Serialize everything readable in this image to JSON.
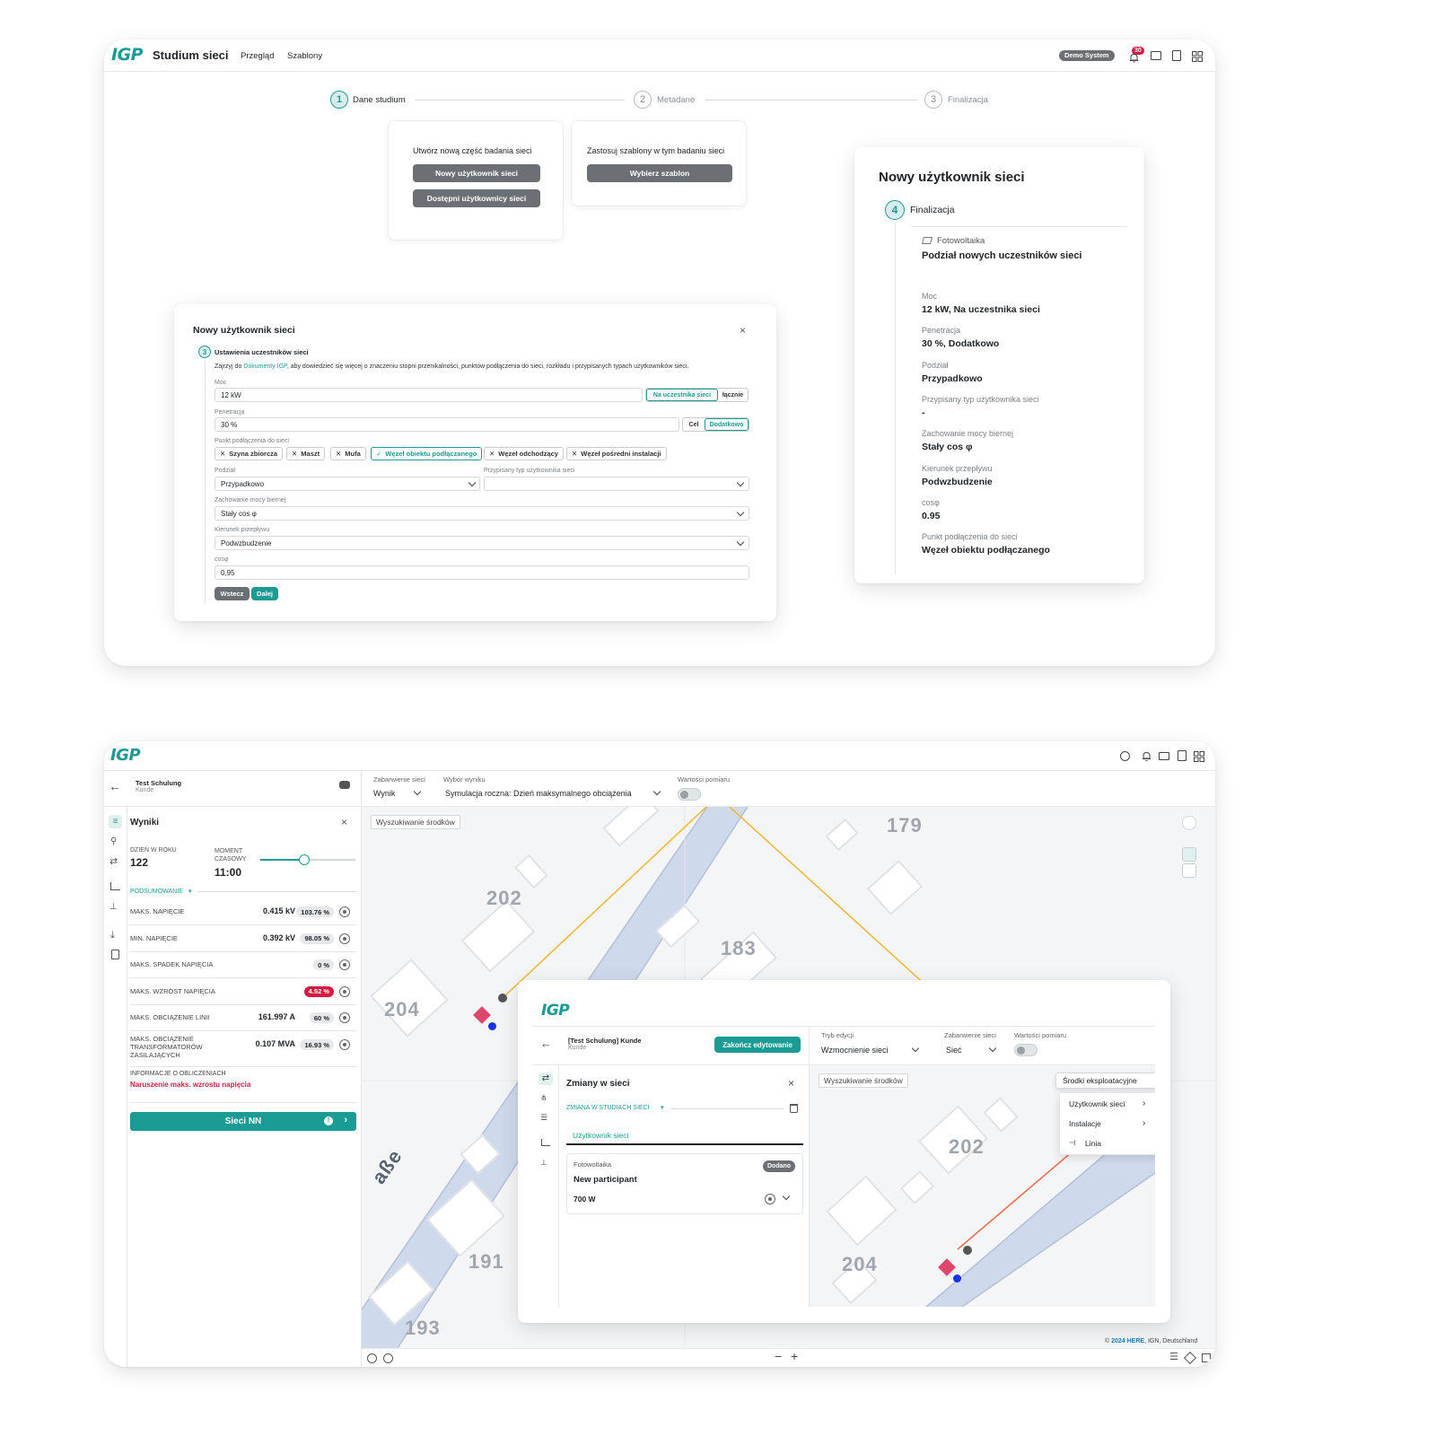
{
  "top": {
    "logo": "IGP",
    "app_title": "Studium sieci",
    "nav": [
      "Przegląd",
      "Szablony"
    ],
    "demo_badge": "Demo System",
    "notification_count": "30",
    "steps": [
      {
        "num": "1",
        "label": "Dane studium"
      },
      {
        "num": "2",
        "label": "Metadane"
      },
      {
        "num": "3",
        "label": "Finalizacja"
      }
    ],
    "create_card": {
      "text": "Utwórz nową część badania sieci",
      "btn_new": "Nowy użytkownik sieci",
      "btn_available": "Dostępni użytkownicy sieci"
    },
    "template_card": {
      "text": "Zastosuj szablony w tym badaniu sieci",
      "btn": "Wybierz szablon"
    },
    "dialog": {
      "title": "Nowy użytkownik sieci",
      "step_num": "3",
      "step_title": "Ustawienia uczestników sieci",
      "info_prefix": "Zajrzyj do ",
      "info_link": "Dokumenty IGP",
      "info_suffix": ", aby dowiedzieć się więcej o znaczeniu stopni przenikalności, punktów podłączenia do sieci, rozkładu i przypisanych typach użytkowników sieci.",
      "moc_label": "Moc",
      "moc_value": "12 kW",
      "moc_opt1": "Na uczestnika sieci",
      "moc_opt2": "łącznie",
      "pen_label": "Penetracja",
      "pen_value": "30 %",
      "pen_opt1": "Cel",
      "pen_opt2": "Dodatkowo",
      "punkt_label": "Punkt podłączenia do sieci",
      "chips": [
        "Szyna zbiorcza",
        "Maszt",
        "Mufa",
        "Węzeł obiektu podłączanego",
        "Węzeł odchodzący",
        "Węzeł pośredni instalacji"
      ],
      "podzial_label": "Podział",
      "podzial_value": "Przypadkowo",
      "typ_label": "Przypisany typ użytkownika sieci",
      "typ_value": "",
      "zach_label": "Zachowanie mocy biernej",
      "zach_value": "Stały cos φ",
      "kier_label": "Kierunek przepływu",
      "kier_value": "Podwzbudzenie",
      "cos_label": "cosφ",
      "cos_value": "0,95",
      "btn_back": "Wstecz",
      "btn_next": "Dalej"
    },
    "final_card": {
      "title": "Nowy użytkownik sieci",
      "step_num": "4",
      "step_label": "Finalizacja",
      "category": "Fotowoltaika",
      "subtitle": "Podział nowych uczestników sieci",
      "fields": [
        {
          "label": "Moc",
          "value": "12 kW, Na uczestnika sieci"
        },
        {
          "label": "Penetracja",
          "value": "30 %, Dodatkowo"
        },
        {
          "label": "Podział",
          "value": "Przypadkowo"
        },
        {
          "label": "Przypisany typ użytkownika sieci",
          "value": "-"
        },
        {
          "label": "Zachowanie mocy biernej",
          "value": "Stały cos φ"
        },
        {
          "label": "Kierunek przepływu",
          "value": "Podwzbudzenie"
        },
        {
          "label": "cosφ",
          "value": "0.95"
        },
        {
          "label": "Punkt podłączenia do sieci",
          "value": "Węzeł obiektu podłączanego"
        }
      ]
    }
  },
  "bottom": {
    "logo": "IGP",
    "project_title": "Test Schulung",
    "project_sub": "Kunde",
    "toolbar": {
      "colour_label": "Zabarwienie sieci",
      "colour_value": "Wynik",
      "result_label": "Wybór wyniku",
      "result_value": "Symulacja roczna: Dzień maksymalnego obciążenia",
      "measure_label": "Wartości pomiaru"
    },
    "search_btn": "Wyszukiwanie środków",
    "results": {
      "title": "Wyniki",
      "day_label": "DZIEŃ W ROKU",
      "day_value": "122",
      "moment_label": "MOMENT CZASOWY",
      "moment_value": "11:00",
      "slider_fraction": 0.46,
      "summary_label": "PODSUMOWANIE",
      "rows": [
        {
          "label": "MAKS. NAPIĘCIE",
          "value": "0.415 kV",
          "pct": "103.76 %",
          "red": false
        },
        {
          "label": "MIN. NAPIĘCIE",
          "value": "0.392 kV",
          "pct": "98.05 %",
          "red": false
        },
        {
          "label": "MAKS. SPADEK NAPIĘCIA",
          "value": "",
          "pct": "0 %",
          "red": false
        },
        {
          "label": "MAKS. WZROST NAPIĘCIA",
          "value": "",
          "pct": "4.52 %",
          "red": true
        },
        {
          "label": "MAKS. OBCIĄŻENIE LINII",
          "value": "161.997 A",
          "pct": "60 %",
          "red": false
        },
        {
          "label": "MAKS. OBCIĄŻENIE TRANSFORMATORÓW ZASILAJĄCYCH",
          "value": "0.107 MVA",
          "pct": "16.93 %",
          "red": false
        }
      ],
      "info_label": "INFORMACJE O OBLICZENIACH",
      "info_error": "Naruszenie maks. wzrostu napięcia",
      "nn_button": "Sieci NN"
    },
    "map_labels": [
      "179",
      "202",
      "183",
      "204",
      "191",
      "193",
      "aße"
    ],
    "attribution_prefix": "© ",
    "attribution_link": "2024 HERE",
    "attribution_suffix": ", IGN, Deutschland",
    "inner": {
      "logo": "IGP",
      "project_title": "[Test Schulung] Kunde",
      "project_sub": "Kunde",
      "end_edit_btn": "Zakończ edytowanie",
      "mode_label": "Tryb edycji",
      "mode_value": "Wzmocnienie sieci",
      "colour_label": "Zabarwienie sieci",
      "colour_value": "Sieć",
      "measure_label": "Wartości pomiaru",
      "changes_title": "Zmiany w sieci",
      "changes_section": "ZMIANA W STUDIACH SIECI",
      "tab_label": "Użytkownik sieci",
      "item_category": "Fotowoltaika",
      "item_badge": "Dodano",
      "item_name": "New participant",
      "item_power": "700 W",
      "search_btn": "Wyszukiwanie środków",
      "assets_btn": "Środki eksploatacyjne",
      "menu": [
        "Użytkownik sieci",
        "Instalacje",
        "Linia"
      ],
      "map_labels": [
        "202",
        "204"
      ]
    }
  }
}
